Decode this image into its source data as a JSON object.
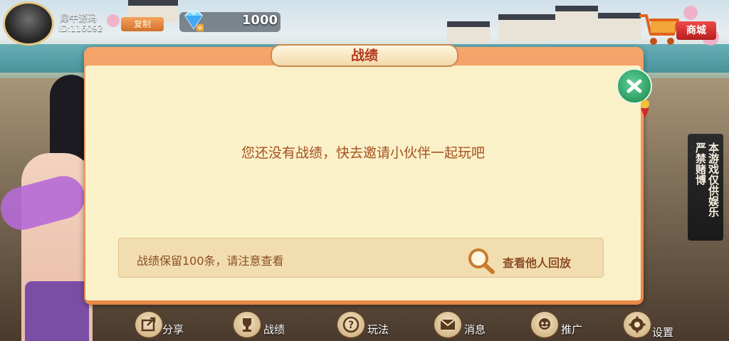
{
  "player": {
    "name": "犀牛源码",
    "id": "ID:116092",
    "copy_label": "复制"
  },
  "currency": {
    "icon": "diamond-icon",
    "value": "1000"
  },
  "shop": {
    "label": "商城",
    "icon": "shopping-cart-icon"
  },
  "dialog": {
    "title": "战绩",
    "empty_message": "您还没有战绩，快去邀请小伙伴一起玩吧",
    "retention_note": "战绩保留100条，请注意查看",
    "view_replay_label": "查看他人回放"
  },
  "notice": {
    "left": "严禁赌博",
    "right": "本游戏仅供娱乐"
  },
  "nav": {
    "items": [
      {
        "label": "分享",
        "icon": "share-icon"
      },
      {
        "label": "战绩",
        "icon": "trophy-icon"
      },
      {
        "label": "玩法",
        "icon": "question-icon"
      },
      {
        "label": "消息",
        "icon": "mail-icon"
      },
      {
        "label": "推广",
        "icon": "promote-icon"
      },
      {
        "label": "设置",
        "icon": "gear-icon"
      }
    ]
  },
  "colors": {
    "dialog_frame": "#e88849",
    "panel": "#fbf1c9",
    "title_text": "#b2381d",
    "message_text": "#a6501f",
    "close_button": "#2a9c60"
  }
}
